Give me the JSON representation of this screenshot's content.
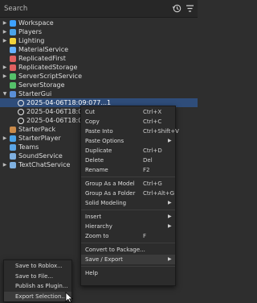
{
  "search": {
    "label": "Search"
  },
  "toolbar": {
    "history_icon": "history-icon",
    "filter_icon": "filter-icon"
  },
  "tree": [
    {
      "label": "Workspace",
      "icon": "workspace-icon",
      "color": "#3ea2ff",
      "expand": "right",
      "indent": 0
    },
    {
      "label": "Players",
      "icon": "players-icon",
      "color": "#4aa3e8",
      "expand": "right",
      "indent": 0
    },
    {
      "label": "Lighting",
      "icon": "lighting-icon",
      "color": "#f2d33a",
      "expand": "right",
      "indent": 0
    },
    {
      "label": "MaterialService",
      "icon": "material-icon",
      "color": "#66b2ff",
      "expand": "none",
      "indent": 0
    },
    {
      "label": "ReplicatedFirst",
      "icon": "replicated-icon",
      "color": "#e06060",
      "expand": "none",
      "indent": 0
    },
    {
      "label": "ReplicatedStorage",
      "icon": "storage-icon",
      "color": "#e06060",
      "expand": "right",
      "indent": 0
    },
    {
      "label": "ServerScriptService",
      "icon": "script-service-icon",
      "color": "#55c06a",
      "expand": "right",
      "indent": 0
    },
    {
      "label": "ServerStorage",
      "icon": "server-storage-icon",
      "color": "#55c06a",
      "expand": "none",
      "indent": 0
    },
    {
      "label": "StarterGui",
      "icon": "starter-gui-icon",
      "color": "#5a8fd8",
      "expand": "down",
      "indent": 0
    },
    {
      "label": "2025-04-06T18:09:077...1",
      "icon": "globe-icon",
      "color": "#e8e8e8",
      "expand": "none",
      "indent": 1,
      "selected": true
    },
    {
      "label": "2025-04-06T18:09",
      "icon": "globe-icon",
      "color": "#e8e8e8",
      "expand": "none",
      "indent": 1
    },
    {
      "label": "2025-04-06T18:09",
      "icon": "globe-icon",
      "color": "#e8e8e8",
      "expand": "none",
      "indent": 1
    },
    {
      "label": "StarterPack",
      "icon": "starter-pack-icon",
      "color": "#c98a4a",
      "expand": "none",
      "indent": 0
    },
    {
      "label": "StarterPlayer",
      "icon": "starter-player-icon",
      "color": "#4aa3e8",
      "expand": "right",
      "indent": 0
    },
    {
      "label": "Teams",
      "icon": "teams-icon",
      "color": "#5ba5e6",
      "expand": "none",
      "indent": 0
    },
    {
      "label": "SoundService",
      "icon": "sound-icon",
      "color": "#7fb0e0",
      "expand": "none",
      "indent": 0
    },
    {
      "label": "TextChatService",
      "icon": "chat-icon",
      "color": "#7fb0e0",
      "expand": "right",
      "indent": 0
    }
  ],
  "context_menu": [
    {
      "label": "Cut",
      "shortcut": "Ctrl+X"
    },
    {
      "label": "Copy",
      "shortcut": "Ctrl+C"
    },
    {
      "label": "Paste Into",
      "shortcut": "Ctrl+Shift+V"
    },
    {
      "label": "Paste Options",
      "submenu": true
    },
    {
      "label": "Duplicate",
      "shortcut": "Ctrl+D"
    },
    {
      "label": "Delete",
      "shortcut": "Del"
    },
    {
      "label": "Rename",
      "shortcut": "F2"
    },
    {
      "separator": true
    },
    {
      "label": "Group As a Model",
      "shortcut": "Ctrl+G"
    },
    {
      "label": "Group As a Folder",
      "shortcut": "Ctrl+Alt+G"
    },
    {
      "label": "Solid Modeling",
      "submenu": true
    },
    {
      "separator": true
    },
    {
      "label": "Insert",
      "submenu": true
    },
    {
      "label": "Hierarchy",
      "submenu": true
    },
    {
      "label": "Zoom to",
      "shortcut": "F"
    },
    {
      "separator": true
    },
    {
      "label": "Convert to Package..."
    },
    {
      "label": "Save / Export",
      "submenu": true,
      "highlighted": true
    },
    {
      "separator": true
    },
    {
      "label": "Help"
    }
  ],
  "submenu": [
    {
      "label": "Save to Roblox..."
    },
    {
      "label": "Save to File..."
    },
    {
      "label": "Publish as Plugin..."
    },
    {
      "label": "Export Selection...",
      "highlighted": true
    }
  ]
}
